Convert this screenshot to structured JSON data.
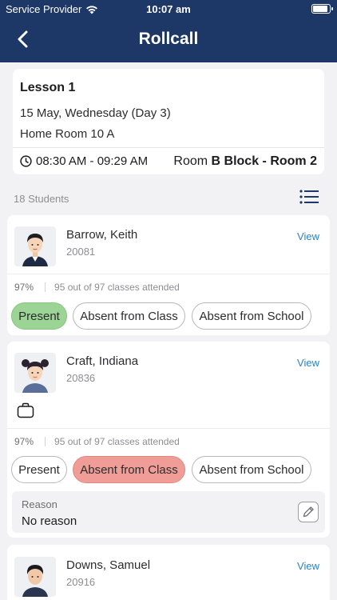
{
  "status_bar": {
    "carrier": "Service Provider",
    "time": "10:07 am"
  },
  "header": {
    "title": "Rollcall"
  },
  "lesson": {
    "title": "Lesson 1",
    "date": "15 May, Wednesday (Day 3)",
    "homeroom": "Home Room 10 A",
    "time_range": "08:30 AM - 09:29 AM",
    "room_prefix": "Room",
    "room_name": "B Block - Room 2"
  },
  "students_count": "18 Students",
  "students": [
    {
      "name": "Barrow, Keith",
      "id": "20081",
      "view_label": "View",
      "attendance_pct": "97%",
      "attendance_text": "95 out of 97 classes attended",
      "options": [
        "Present",
        "Absent from Class",
        "Absent from School"
      ],
      "selected": "Present"
    },
    {
      "name": "Craft, Indiana",
      "id": "20836",
      "view_label": "View",
      "attendance_pct": "97%",
      "attendance_text": "95 out of 97 classes attended",
      "options": [
        "Present",
        "Absent from Class",
        "Absent from School"
      ],
      "selected": "Absent from Class",
      "reason_label": "Reason",
      "reason_value": "No reason"
    },
    {
      "name": "Downs, Samuel",
      "id": "20916",
      "view_label": "View"
    }
  ],
  "colors": {
    "header": "#1d3766",
    "present": "#9bd495",
    "absent": "#f19d97",
    "link": "#2a84c6"
  },
  "icons": [
    "wifi-icon",
    "battery-icon",
    "back-chevron-icon",
    "clock-icon",
    "list-filter-icon",
    "bag-icon",
    "edit-pencil-icon"
  ]
}
